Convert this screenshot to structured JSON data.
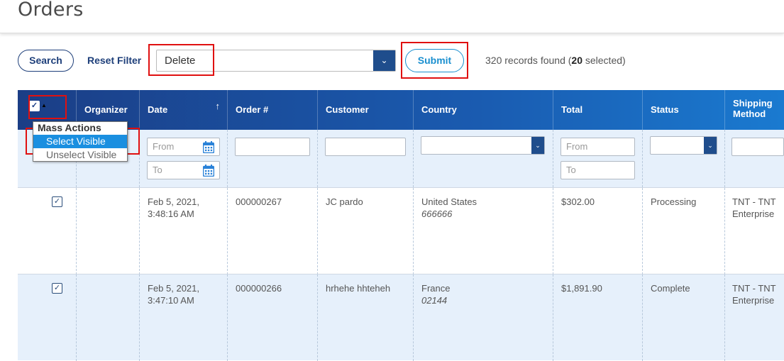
{
  "page": {
    "title": "Orders"
  },
  "toolbar": {
    "search_label": "Search",
    "reset_label": "Reset Filter",
    "action_value": "Delete",
    "submit_label": "Submit",
    "records_prefix": "320 records found (",
    "records_selected_count": "20",
    "records_suffix": " selected)"
  },
  "columns": [
    "Organizer",
    "Date",
    "Order #",
    "Customer",
    "Country",
    "Total",
    "Status",
    "Shipping Method"
  ],
  "filters": {
    "date_from_placeholder": "From",
    "date_to_placeholder": "To",
    "total_from_placeholder": "From",
    "total_to_placeholder": "To"
  },
  "mass_actions": {
    "header": "Mass Actions",
    "items": [
      "Select Visible",
      "Unselect Visible"
    ]
  },
  "rows": [
    {
      "checked": true,
      "organizer": "",
      "date": "Feb 5, 2021,",
      "time": "3:48:16 AM",
      "order": "000000267",
      "customer": "JC pardo",
      "country": "United States",
      "postcode": "666666",
      "total": "$302.00",
      "status": "Processing",
      "shipping_1": "TNT - TNT",
      "shipping_2": "Enterprise"
    },
    {
      "checked": true,
      "organizer": "",
      "date": "Feb 5, 2021,",
      "time": "3:47:10 AM",
      "order": "000000266",
      "customer": "hrhehe hhteheh",
      "country": "France",
      "postcode": "02144",
      "total": "$1,891.90",
      "status": "Complete",
      "shipping_1": "TNT - TNT",
      "shipping_2": "Enterprise"
    }
  ],
  "colors": {
    "header_start": "#1b3e86",
    "header_end": "#1a7ad0",
    "accent": "#1a8fcf",
    "highlight": "#e01010"
  }
}
